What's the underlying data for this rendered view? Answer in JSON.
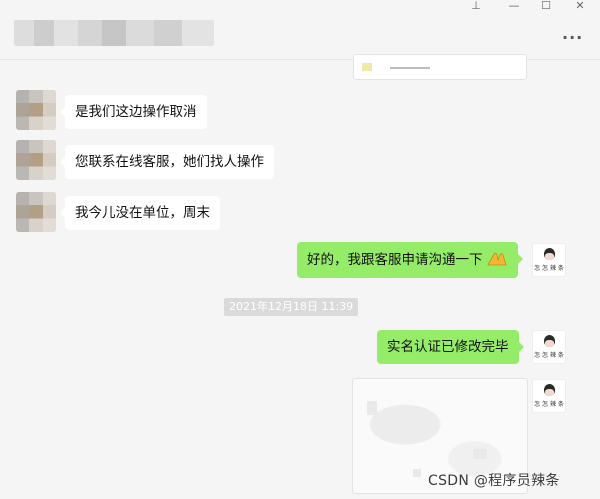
{
  "window": {
    "pin_glyph": "⊥",
    "minimize_glyph": "—",
    "maximize_glyph": "☐",
    "close_glyph": "✕",
    "more_glyph": "···"
  },
  "messages": [
    {
      "side": "left",
      "text": "是我们这边操作取消"
    },
    {
      "side": "left",
      "text": "您联系在线客服，她们找人操作"
    },
    {
      "side": "left",
      "text": "我今儿没在单位，周末"
    },
    {
      "side": "right",
      "text": "好的，我跟客服申请沟通一下",
      "emoji": "raised-hands-icon"
    },
    {
      "side": "right",
      "text": "实名认证已修改完毕"
    }
  ],
  "timestamp": "2021年12月18日 11:39",
  "self_avatar_caption": "怎 怎 辣 条",
  "watermark": "CSDN @程序员辣条",
  "colors": {
    "background": "#f5f5f5",
    "bubble_self": "#95ec69",
    "bubble_other": "#ffffff",
    "timestamp_bg": "#dadada"
  }
}
